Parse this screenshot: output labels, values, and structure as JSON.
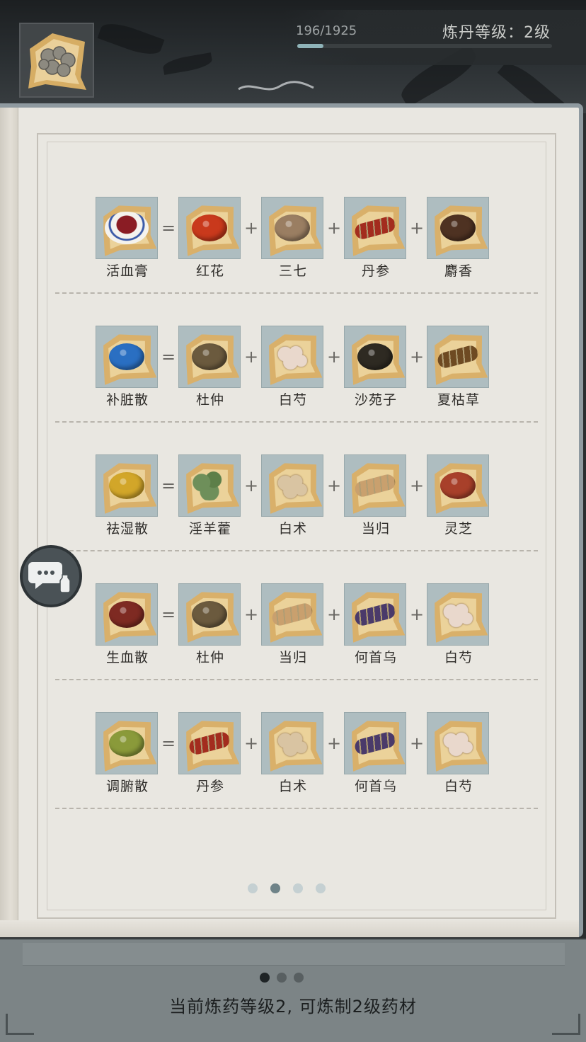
{
  "header": {
    "exp_text": "196/1925",
    "exp_fraction": 0.102,
    "level_text": "炼丹等级：2级"
  },
  "recipes": [
    {
      "result": {
        "name": "活血膏",
        "icon": "ointment-jar-icon",
        "color": "#8a1c24"
      },
      "ingredients": [
        {
          "name": "红花",
          "icon": "safflower-icon",
          "color": "#c9391c"
        },
        {
          "name": "三七",
          "icon": "notoginseng-icon",
          "color": "#9a7e62"
        },
        {
          "name": "丹参",
          "icon": "red-sage-root-icon",
          "color": "#a32c1e"
        },
        {
          "name": "麝香",
          "icon": "musk-icon",
          "color": "#4e3222"
        }
      ]
    },
    {
      "result": {
        "name": "补脏散",
        "icon": "blue-powder-icon",
        "color": "#2a6fc2"
      },
      "ingredients": [
        {
          "name": "杜仲",
          "icon": "eucommia-bark-icon",
          "color": "#6b5a3e"
        },
        {
          "name": "白芍",
          "icon": "white-peony-slices-icon",
          "color": "#e9d8cc"
        },
        {
          "name": "沙苑子",
          "icon": "astragalus-seed-icon",
          "color": "#2e2a22"
        },
        {
          "name": "夏枯草",
          "icon": "prunella-icon",
          "color": "#6e4a22"
        }
      ]
    },
    {
      "result": {
        "name": "祛湿散",
        "icon": "yellow-powder-icon",
        "color": "#d2a629"
      },
      "ingredients": [
        {
          "name": "淫羊藿",
          "icon": "epimedium-leaves-icon",
          "color": "#6e8f5a"
        },
        {
          "name": "白术",
          "icon": "atractylodes-icon",
          "color": "#d9c4a2"
        },
        {
          "name": "当归",
          "icon": "angelica-root-icon",
          "color": "#c9a06e"
        },
        {
          "name": "灵芝",
          "icon": "lingzhi-icon",
          "color": "#a8402a"
        }
      ]
    },
    {
      "result": {
        "name": "生血散",
        "icon": "red-powder-icon",
        "color": "#7e2a22"
      },
      "ingredients": [
        {
          "name": "杜仲",
          "icon": "eucommia-bark-icon",
          "color": "#6b5a3e"
        },
        {
          "name": "当归",
          "icon": "angelica-root-icon",
          "color": "#c9a06e"
        },
        {
          "name": "何首乌",
          "icon": "fleeceflower-root-icon",
          "color": "#4a3a6a"
        },
        {
          "name": "白芍",
          "icon": "white-peony-slices-icon",
          "color": "#e9d8cc"
        }
      ]
    },
    {
      "result": {
        "name": "调腑散",
        "icon": "green-powder-icon",
        "color": "#8a9a3a"
      },
      "ingredients": [
        {
          "name": "丹参",
          "icon": "red-sage-root-icon",
          "color": "#a32c1e"
        },
        {
          "name": "白术",
          "icon": "atractylodes-icon",
          "color": "#d9c4a2"
        },
        {
          "name": "何首乌",
          "icon": "fleeceflower-root-icon",
          "color": "#4a3a6a"
        },
        {
          "name": "白芍",
          "icon": "white-peony-slices-icon",
          "color": "#e9d8cc"
        }
      ]
    }
  ],
  "operators": {
    "equals": "=",
    "plus": "+"
  },
  "pager": {
    "count": 4,
    "active": 1
  },
  "footer": {
    "page_count": 3,
    "page_active": 0,
    "status_text": "当前炼药等级2, 可炼制2级药材"
  },
  "colors": {
    "tile_bg": "#aebdc0",
    "paper": "#e9e7e1",
    "accent_dot": "#6f8388"
  }
}
